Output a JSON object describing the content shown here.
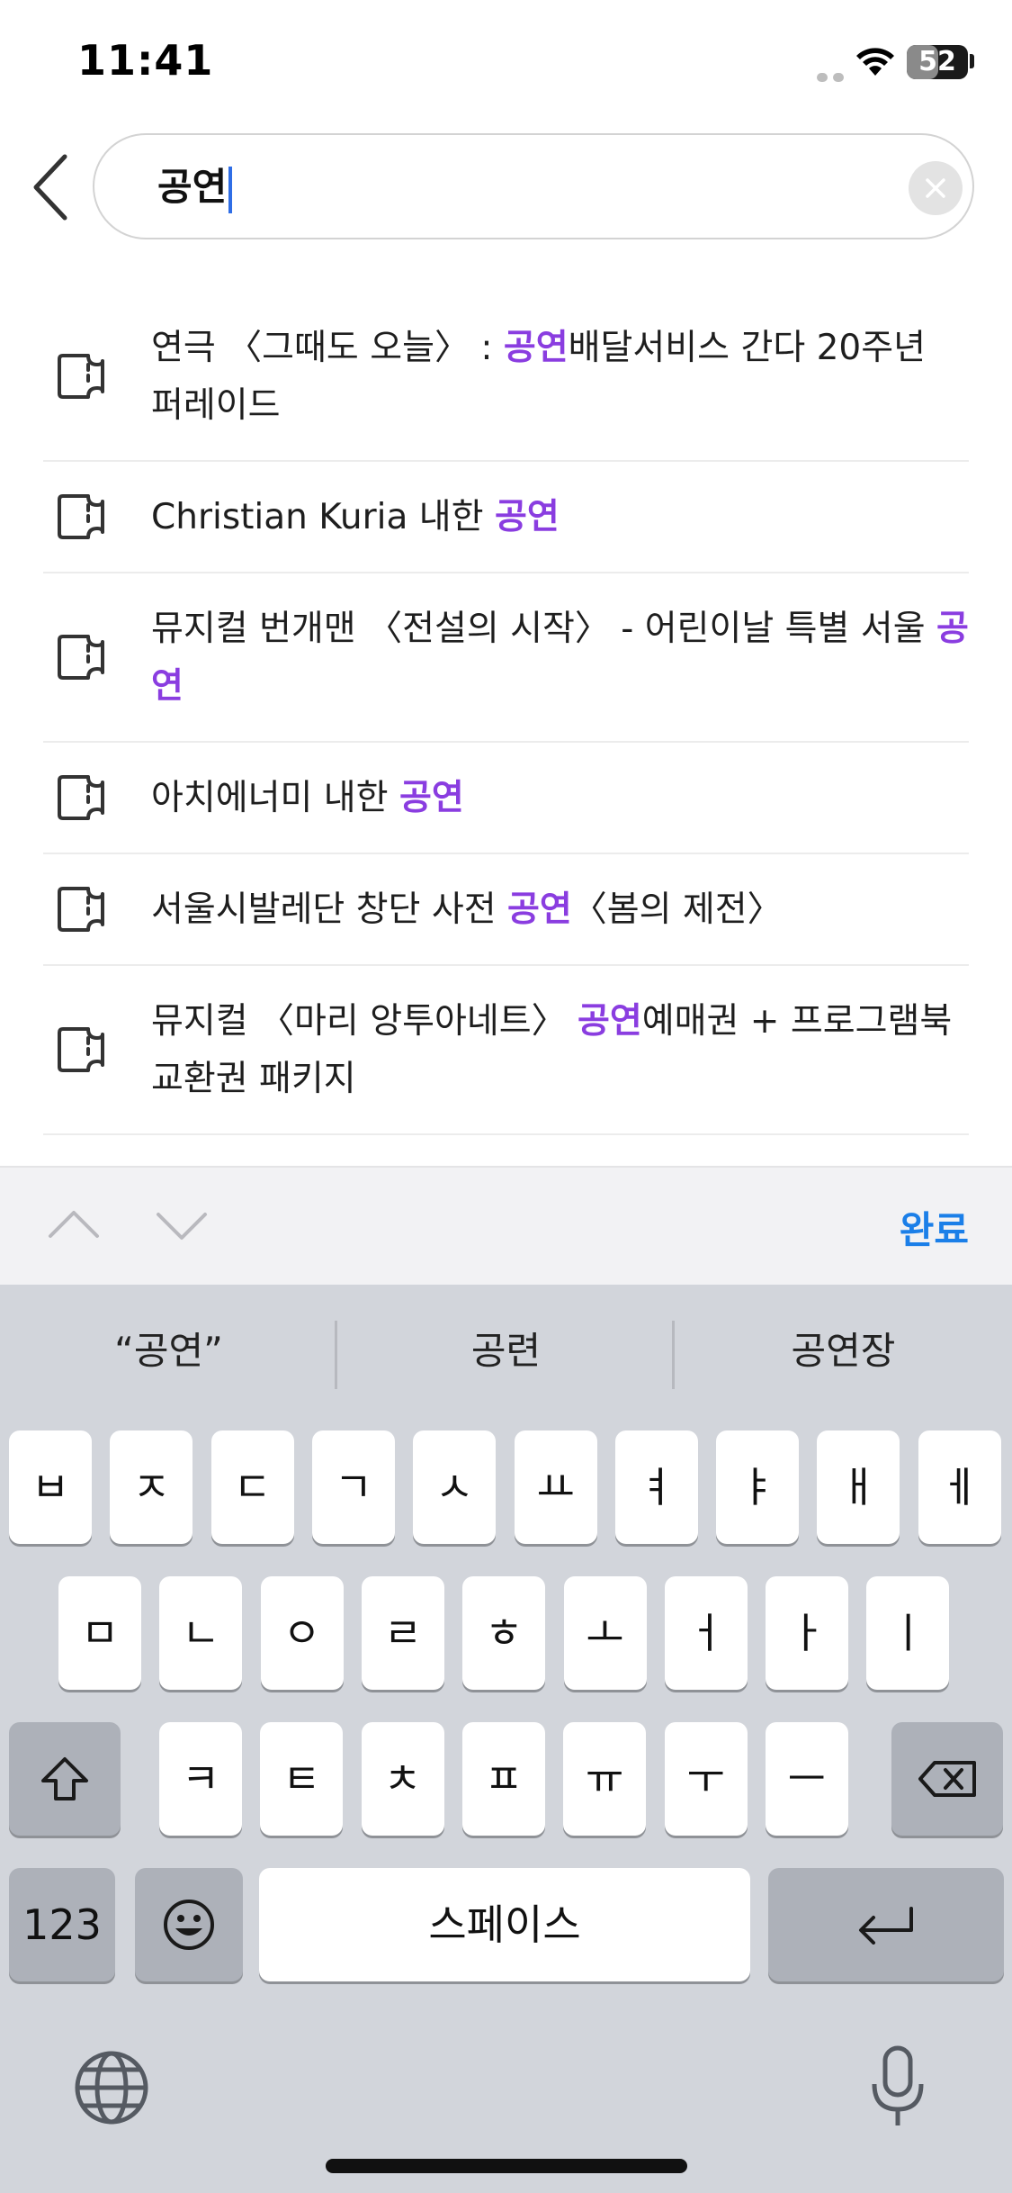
{
  "status": {
    "time": "11:41",
    "battery": "52",
    "battery_level": 0.52
  },
  "search": {
    "value": "공연"
  },
  "results": [
    {
      "pre": "연극 〈그때도 오늘〉 : ",
      "hl": "공연",
      "post": "배달서비스 간다 20주년 퍼레이드"
    },
    {
      "pre": "Christian Kuria 내한 ",
      "hl": "공연",
      "post": ""
    },
    {
      "pre": "뮤지컬 번개맨 〈전설의 시작〉 - 어린이날 특별 서울 ",
      "hl": "공연",
      "post": ""
    },
    {
      "pre": "아치에너미 내한 ",
      "hl": "공연",
      "post": ""
    },
    {
      "pre": "서울시발레단 창단 사전 ",
      "hl": "공연",
      "post": "〈봄의 제전〉"
    },
    {
      "pre": "뮤지컬 〈마리 앙투아네트〉 ",
      "hl": "공연",
      "post": "예매권 + 프로그램북 교환권 패키지"
    }
  ],
  "accessory": {
    "done_label": "완료"
  },
  "keyboard": {
    "suggestions": [
      "“공연”",
      "공련",
      "공연장"
    ],
    "row1": [
      "ㅂ",
      "ㅈ",
      "ㄷ",
      "ㄱ",
      "ㅅ",
      "ㅛ",
      "ㅕ",
      "ㅑ",
      "ㅐ",
      "ㅔ"
    ],
    "row2": [
      "ㅁ",
      "ㄴ",
      "ㅇ",
      "ㄹ",
      "ㅎ",
      "ㅗ",
      "ㅓ",
      "ㅏ",
      "ㅣ"
    ],
    "row3": [
      "ㅋ",
      "ㅌ",
      "ㅊ",
      "ㅍ",
      "ㅠ",
      "ㅜ",
      "ㅡ"
    ],
    "numbers_label": "123",
    "space_label": "스페이스"
  }
}
